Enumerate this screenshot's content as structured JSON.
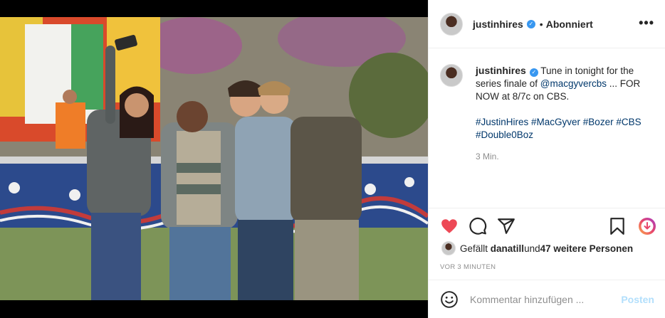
{
  "post": {
    "username": "justinhires",
    "follow_status": "Abonniert",
    "more_icon": "more-horizontal-icon",
    "caption": {
      "username": "justinhires",
      "text_before_link": " Tune in tonight for the series finale of ",
      "mention": "@macgyvercbs",
      "text_after_link": " ... FOR NOW at 8/7c on CBS.",
      "hashtags": "#JustinHires #MacGyver #Bozer #CBS #Double0Boz",
      "time": "3 Min."
    },
    "actions": {
      "like_icon": "heart-filled-icon",
      "comment_icon": "comment-icon",
      "share_icon": "paper-plane-icon",
      "save_icon": "bookmark-icon",
      "extra_icon": "download-circle-icon",
      "like_color": "#ed4956"
    },
    "likes": {
      "prefix": "Gefällt ",
      "user": "danatill",
      "middle": " und ",
      "count_text": "47 weitere Personen"
    },
    "posted_ago": "VOR 3 MINUTEN",
    "comment_box": {
      "placeholder": "Kommentar hinzufügen ...",
      "post_label": "Posten",
      "emoji_icon": "smiley-icon"
    }
  }
}
